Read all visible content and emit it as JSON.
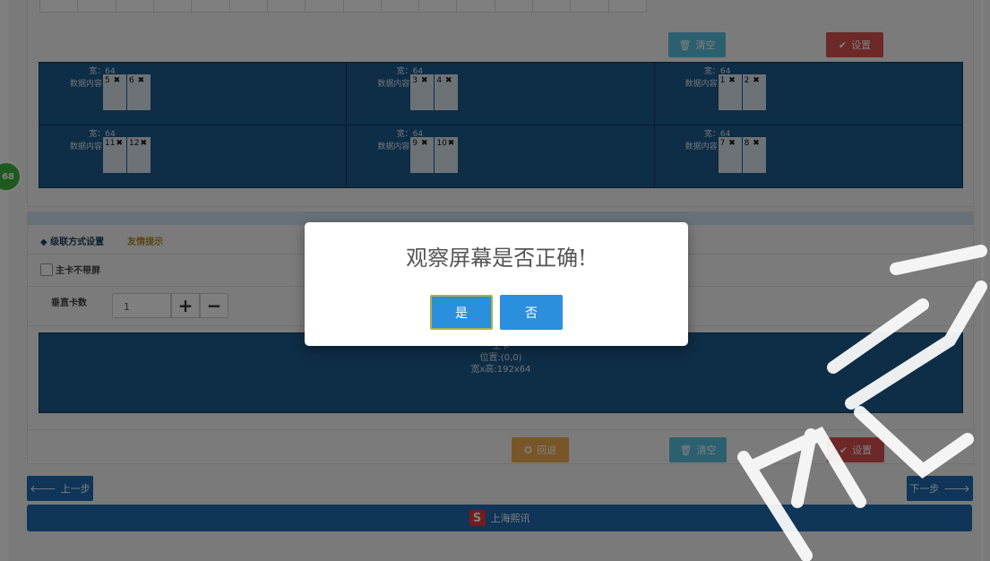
{
  "top_panel": {
    "clear_label": "清空",
    "set_label": "设置",
    "cards": [
      {
        "width_label": "宽：64",
        "content_label": "数据内容",
        "ports": [
          "5",
          "6"
        ]
      },
      {
        "width_label": "宽：64",
        "content_label": "数据内容",
        "ports": [
          "3",
          "4"
        ]
      },
      {
        "width_label": "宽：64",
        "content_label": "数据内容",
        "ports": [
          "1",
          "2"
        ]
      },
      {
        "width_label": "宽：64",
        "content_label": "数据内容",
        "ports": [
          "11",
          "12"
        ]
      },
      {
        "width_label": "宽：64",
        "content_label": "数据内容",
        "ports": [
          "9",
          "10"
        ]
      },
      {
        "width_label": "宽：64",
        "content_label": "数据内容",
        "ports": [
          "7",
          "8"
        ]
      }
    ],
    "remove_glyph": "✖"
  },
  "side_badge": "68",
  "cascade_panel": {
    "tab_active": "级联方式设置",
    "tab_tip": "友情提示",
    "checkbox_label": "主卡不带屏",
    "vertical_label": "垂直卡数",
    "vertical_value": "1",
    "plus": "+",
    "minus": "−",
    "main_card": {
      "title": "主卡",
      "position": "位置:(0,0)",
      "size": "宽x高:192x64"
    },
    "redo_label": "回退",
    "clear_label": "清空",
    "set_label": "设置"
  },
  "nav": {
    "prev": "上一步",
    "next": "下一步"
  },
  "footer": {
    "company": "上海熙讯"
  },
  "modal": {
    "question": "观察屏幕是否正确!",
    "yes": "是",
    "no": "否"
  },
  "colors": {
    "card_blue": "#1d5a8c",
    "button_blue": "#2a8fdd",
    "danger_red": "#d9534f",
    "info_teal": "#5bc0de",
    "warning_orange": "#f0ad4e"
  }
}
